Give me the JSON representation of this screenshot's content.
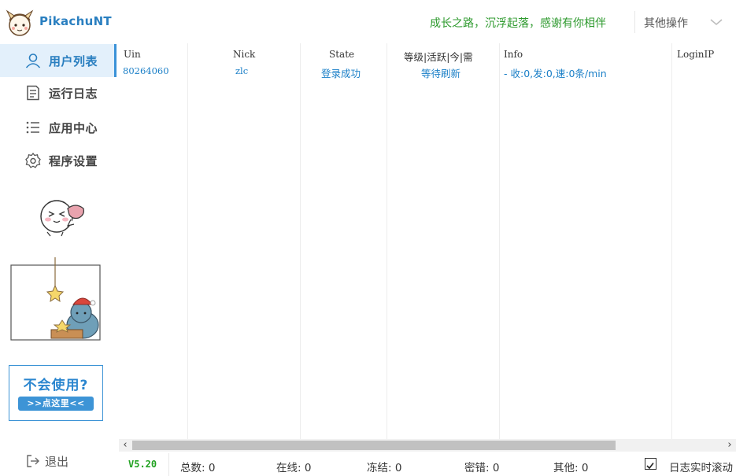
{
  "app": {
    "title": "PikachuNT"
  },
  "header": {
    "slogan": "成长之路，沉浮起落，感谢有你相伴",
    "menu_label": "其他操作"
  },
  "sidebar": {
    "items": [
      {
        "label": "用户列表",
        "icon": "user-icon",
        "active": true
      },
      {
        "label": "运行日志",
        "icon": "log-icon",
        "active": false
      },
      {
        "label": "应用中心",
        "icon": "list-icon",
        "active": false
      },
      {
        "label": "程序设置",
        "icon": "gear-icon",
        "active": false
      }
    ],
    "help": {
      "title": "不会使用?",
      "button": ">>点这里<<"
    },
    "logout_label": "退出"
  },
  "table": {
    "columns": [
      "Uin",
      "Nick",
      "State",
      "等级|活跃|今|需",
      "Info",
      "LoginIP"
    ],
    "rows": [
      {
        "uin": "80264060",
        "nick": "zlc",
        "state": "登录成功",
        "level": "等待刷新",
        "info": "- 收:0,发:0,速:0条/min",
        "loginip": ""
      }
    ]
  },
  "status": {
    "version": "V5.20",
    "total": "总数: 0",
    "online": "在线: 0",
    "frozen": "冻结: 0",
    "password_error": "密错: 0",
    "other": "其他: 0",
    "log_scroll_label": "日志实时滚动",
    "log_scroll_checked": true
  },
  "colors": {
    "accent": "#2a7fc0",
    "slogan": "#2e9a2e",
    "version": "#22a222",
    "cell_text": "#1a7fc7",
    "active_bg": "#e3f0fb"
  }
}
